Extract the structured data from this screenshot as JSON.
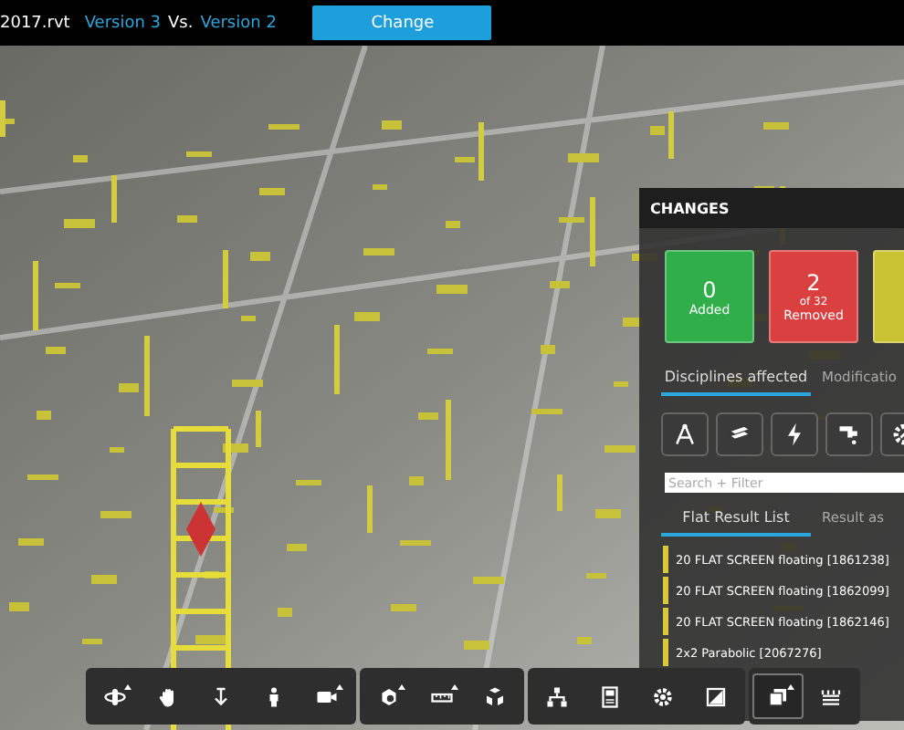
{
  "header": {
    "file_name": "2017.rvt",
    "version_a": "Version 3",
    "separator": "Vs.",
    "version_b": "Version 2",
    "button": "Change"
  },
  "changes_panel": {
    "title": "CHANGES",
    "cards": [
      {
        "kind": "added",
        "count": "0",
        "label": "Added"
      },
      {
        "kind": "removed",
        "count": "2",
        "of": "of 32",
        "label": "Removed"
      },
      {
        "kind": "modified"
      }
    ],
    "tabs": [
      {
        "label": "Disciplines affected",
        "selected": true
      },
      {
        "label": "Modificatio",
        "selected": false
      }
    ],
    "disciplines": [
      {
        "kind": "architecture"
      },
      {
        "kind": "structure"
      },
      {
        "kind": "electrical"
      },
      {
        "kind": "plumbing"
      },
      {
        "kind": "mechanical"
      }
    ],
    "search": {
      "placeholder": "Search + Filter"
    },
    "result_tabs": [
      {
        "label": "Flat Result List",
        "selected": true
      },
      {
        "label": "Result as",
        "selected": false
      }
    ],
    "results": [
      "20 FLAT SCREEN floating [1861238]",
      "20 FLAT SCREEN floating [1862099]",
      "20 FLAT SCREEN floating [1862146]",
      "2x2 Parabolic [2067276]"
    ]
  },
  "toolbar": [
    [
      {
        "kind": "orbit",
        "selected": false
      },
      {
        "kind": "pan",
        "selected": false
      },
      {
        "kind": "zoom",
        "selected": false
      },
      {
        "kind": "person",
        "selected": false
      },
      {
        "kind": "camera",
        "selected": false
      }
    ],
    [
      {
        "kind": "section",
        "selected": false
      },
      {
        "kind": "measure",
        "selected": false
      },
      {
        "kind": "explode",
        "selected": false
      }
    ],
    [
      {
        "kind": "tree",
        "selected": false
      },
      {
        "kind": "properties",
        "selected": false
      },
      {
        "kind": "settings",
        "selected": false
      },
      {
        "kind": "fullscreen",
        "selected": false
      }
    ],
    [
      {
        "kind": "copy",
        "selected": true
      },
      {
        "kind": "layers",
        "selected": false
      }
    ]
  ]
}
